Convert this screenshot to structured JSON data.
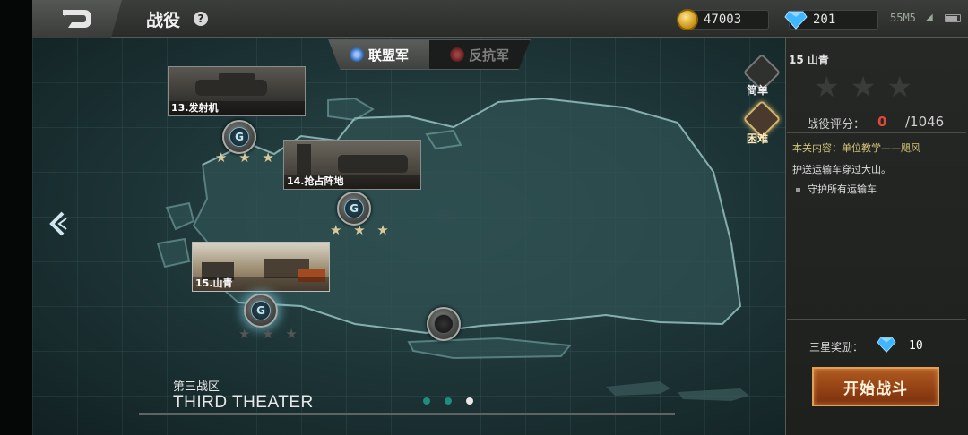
{
  "header": {
    "title": "战役",
    "help_icon": "?",
    "coins": "47003",
    "gems": "201",
    "network": "55M5"
  },
  "faction_tabs": [
    {
      "label": "联盟军",
      "icon": "alliance-emblem-icon",
      "selected": true
    },
    {
      "label": "反抗军",
      "icon": "resistance-emblem-icon",
      "selected": false
    }
  ],
  "map": {
    "missions": [
      {
        "id": "13",
        "label": "13.发射机",
        "stars": "★ ★ ★",
        "earned_stars": 3
      },
      {
        "id": "14",
        "label": "14.抢占阵地",
        "stars": "★ ★ ★",
        "earned_stars": 3
      },
      {
        "id": "15",
        "label": "15.山青",
        "stars": "★ ★ ★",
        "earned_stars": 0
      }
    ],
    "node_icon": "G",
    "difficulty": [
      {
        "label": "简单",
        "selected": false
      },
      {
        "label": "困难",
        "selected": true
      }
    ],
    "theater_cn": "第三战区",
    "theater_en": "THIRD THEATER",
    "pages": 3,
    "active_page": 3
  },
  "panel": {
    "mission_title": "15  山青",
    "stars": "★★★",
    "earned_stars": 0,
    "score_label": "战役评分：",
    "score_value": "0",
    "score_max": "/1046",
    "content_label": "本关内容：单位教学——飓风",
    "objective_desc": "护送运输车穿过大山。",
    "objectives": [
      "守护所有运输车"
    ],
    "reward_label": "三星奖励：",
    "reward_amount": "10",
    "start_button": "开始战斗"
  },
  "colors": {
    "accent_orange": "#b05a21",
    "score_red": "#e0483b",
    "star_gold": "#d8c99a",
    "gem_blue": "#3fb6ff",
    "teal_dot": "#1f8c7e"
  }
}
